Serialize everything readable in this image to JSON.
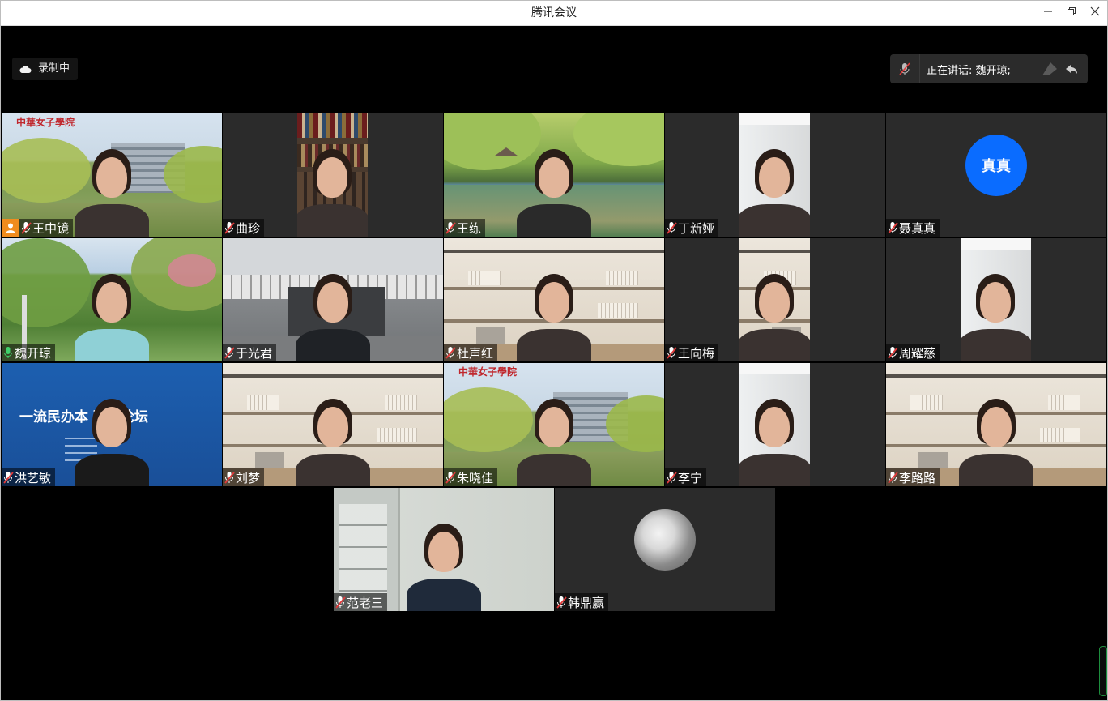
{
  "window": {
    "title": "腾讯会议",
    "controls": [
      "minimize",
      "restore",
      "close"
    ]
  },
  "recording": {
    "label": "录制中"
  },
  "speaking": {
    "label": "正在讲话: 魏开琼;"
  },
  "participants": [
    {
      "name": "王中镜",
      "mic": "muted",
      "host": true,
      "video": "full",
      "bg": "campus-logo"
    },
    {
      "name": "曲珍",
      "mic": "muted",
      "video": "narrow",
      "bg": "bookshelf"
    },
    {
      "name": "王练",
      "mic": "muted",
      "video": "full",
      "bg": "lake"
    },
    {
      "name": "丁新娅",
      "mic": "muted",
      "video": "narrow",
      "bg": "white-room"
    },
    {
      "name": "聂真真",
      "mic": "muted",
      "video": "none",
      "avatar_text": "真真"
    },
    {
      "name": "魏开琼",
      "mic": "active",
      "video": "full",
      "bg": "garden"
    },
    {
      "name": "于光君",
      "mic": "muted",
      "video": "full",
      "bg": "gate"
    },
    {
      "name": "杜声红",
      "mic": "muted",
      "video": "full",
      "bg": "shelf-room"
    },
    {
      "name": "王向梅",
      "mic": "muted",
      "video": "narrow",
      "bg": "shelf-room"
    },
    {
      "name": "周耀慈",
      "mic": "muted",
      "video": "narrow",
      "bg": "white-room"
    },
    {
      "name": "洪艺敏",
      "mic": "muted",
      "video": "full",
      "bg": "blue-banner",
      "banner_text": "一流民办本  建设论坛"
    },
    {
      "name": "刘梦",
      "mic": "muted",
      "video": "full",
      "bg": "shelf-room"
    },
    {
      "name": "朱晓佳",
      "mic": "muted",
      "video": "full",
      "bg": "campus-logo"
    },
    {
      "name": "李宁",
      "mic": "muted",
      "video": "narrow",
      "bg": "white-room"
    },
    {
      "name": "李路路",
      "mic": "muted",
      "video": "full",
      "bg": "shelf-room"
    },
    {
      "name": "范老三",
      "mic": "muted",
      "video": "full",
      "bg": "office"
    },
    {
      "name": "韩鼎赢",
      "mic": "muted",
      "video": "none",
      "avatar_image": "blossom"
    }
  ],
  "colors": {
    "host_badge": "#f08c1e",
    "avatar_blue": "#0a6cff",
    "active_mic": "#3fd16b",
    "muted_mic": "#e03a3a",
    "tile_bg": "#2b2b2b"
  },
  "logo_text": "中華女子學院"
}
